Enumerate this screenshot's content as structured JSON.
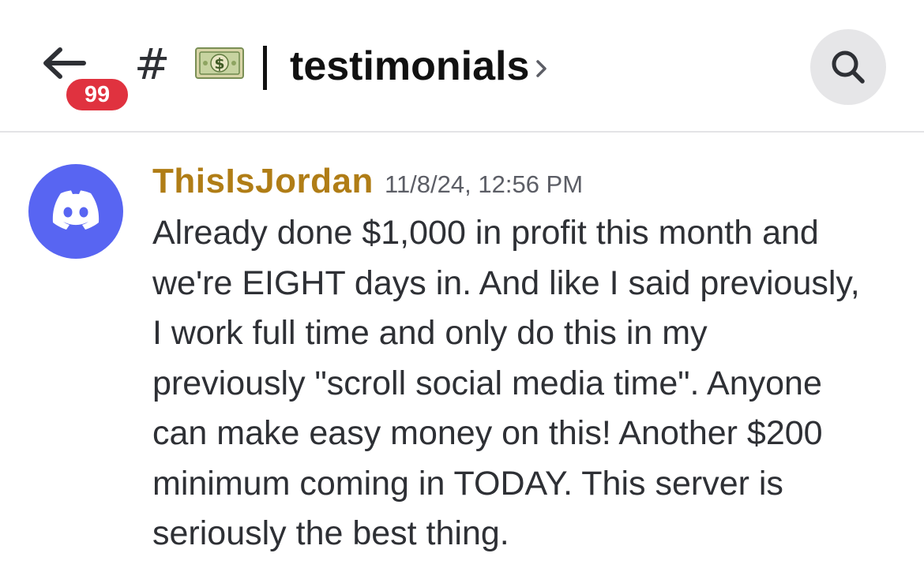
{
  "header": {
    "back_icon": "arrow-left-icon",
    "unread_badge": "99",
    "channel_prefix_icon": "hash-icon",
    "channel_emoji_icon": "money-bag-dollar-icon",
    "channel_name": "testimonials",
    "chevron_icon": "chevron-right-icon",
    "search_icon": "search-icon"
  },
  "message": {
    "author": "ThisIsJordan",
    "author_color": "#b07d16",
    "avatar_icon": "discord-logo-icon",
    "avatar_color": "#5865f2",
    "timestamp": "11/8/24, 12:56 PM",
    "lines": [
      "Already done $1,000 in profit this month and",
      "we're EIGHT days in. And like I said previously,",
      "I work full time and only do this in my",
      "previously \"scroll social media time\". Anyone",
      "can make easy money on this! Another $200",
      "minimum coming in TODAY. This server is",
      "seriously the best thing."
    ]
  }
}
